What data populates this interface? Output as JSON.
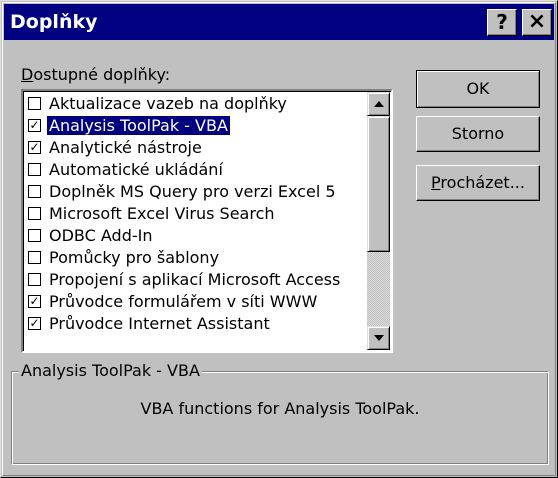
{
  "window": {
    "title": "Doplňky",
    "help_label": "?",
    "close_label": "×"
  },
  "list": {
    "label_mnemonic": "D",
    "label_rest": "ostupné doplňky:",
    "items": [
      {
        "label": "Aktualizace vazeb na doplňky",
        "checked": false,
        "selected": false
      },
      {
        "label": "Analysis ToolPak - VBA",
        "checked": true,
        "selected": true
      },
      {
        "label": "Analytické nástroje",
        "checked": true,
        "selected": false
      },
      {
        "label": "Automatické ukládání",
        "checked": false,
        "selected": false
      },
      {
        "label": "Doplněk MS Query pro verzi Excel 5",
        "checked": false,
        "selected": false
      },
      {
        "label": "Microsoft Excel Virus Search",
        "checked": false,
        "selected": false
      },
      {
        "label": "ODBC Add-In",
        "checked": false,
        "selected": false
      },
      {
        "label": "Pomůcky pro šablony",
        "checked": false,
        "selected": false
      },
      {
        "label": "Propojení s aplikací Microsoft Access",
        "checked": false,
        "selected": false
      },
      {
        "label": "Průvodce formulářem v síti WWW",
        "checked": true,
        "selected": false
      },
      {
        "label": "Průvodce Internet Assistant",
        "checked": true,
        "selected": false
      }
    ]
  },
  "buttons": {
    "ok": "OK",
    "cancel": "Storno",
    "browse_mnemonic": "P",
    "browse_rest": "rocházet..."
  },
  "details": {
    "title": "Analysis ToolPak - VBA",
    "description": "VBA functions for Analysis ToolPak."
  },
  "colors": {
    "titlebar": "#000080",
    "face": "#c0c0c0",
    "selection": "#000080"
  }
}
